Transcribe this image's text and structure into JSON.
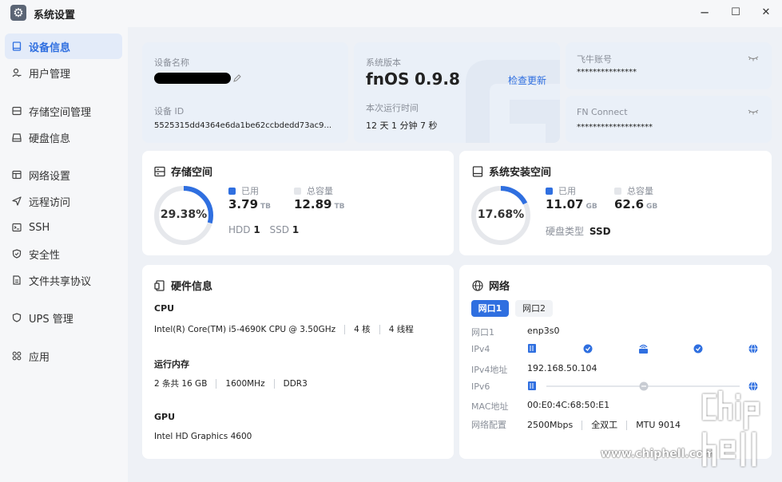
{
  "window": {
    "title": "系统设置",
    "minimize": "─",
    "maximize": "☐",
    "close": "✕"
  },
  "sidebar": {
    "items": [
      {
        "label": "设备信息"
      },
      {
        "label": "用户管理"
      },
      {
        "label": "存储空间管理"
      },
      {
        "label": "硬盘信息"
      },
      {
        "label": "网络设置"
      },
      {
        "label": "远程访问"
      },
      {
        "label": "SSH"
      },
      {
        "label": "安全性"
      },
      {
        "label": "文件共享协议"
      },
      {
        "label": "UPS 管理"
      },
      {
        "label": "应用"
      }
    ]
  },
  "device": {
    "name_label": "设备名称",
    "id_label": "设备 ID",
    "id_value": "5525315dd4364e6da1be62ccbdedd73ac9..."
  },
  "system": {
    "version_label": "系统版本",
    "os_name": "fnOS",
    "os_version": "0.9.8",
    "check_update": "检查更新",
    "uptime_label": "本次运行时间",
    "uptime_value": "12 天 1 分钟 7 秒"
  },
  "account": {
    "label": "飞牛账号",
    "value": "***************"
  },
  "fnconnect": {
    "label": "FN Connect",
    "value": "*******************"
  },
  "storage": {
    "title": "存储空间",
    "percent": "29.38%",
    "percent_value": 29.38,
    "used_label": "已用",
    "used_value": "3.79",
    "used_unit": "TB",
    "total_label": "总容量",
    "total_value": "12.89",
    "total_unit": "TB",
    "hdd_label": "HDD",
    "hdd_count": "1",
    "ssd_label": "SSD",
    "ssd_count": "1"
  },
  "system_storage": {
    "title": "系统安装空间",
    "percent": "17.68%",
    "percent_value": 17.68,
    "used_label": "已用",
    "used_value": "11.07",
    "used_unit": "GB",
    "total_label": "总容量",
    "total_value": "62.6",
    "total_unit": "GB",
    "disk_type_label": "硬盘类型",
    "disk_type_value": "SSD"
  },
  "hardware": {
    "title": "硬件信息",
    "cpu_label": "CPU",
    "cpu_model": "Intel(R) Core(TM) i5-4690K CPU @ 3.50GHz",
    "cpu_cores": "4 核",
    "cpu_threads": "4 线程",
    "mem_label": "运行内存",
    "mem_size": "2 条共 16 GB",
    "mem_freq": "1600MHz",
    "mem_type": "DDR3",
    "gpu_label": "GPU",
    "gpu_model": "Intel HD Graphics 4600"
  },
  "network": {
    "title": "网络",
    "tabs": [
      {
        "label": "网口1"
      },
      {
        "label": "网口2"
      }
    ],
    "port_label": "网口1",
    "port_value": "enp3s0",
    "ipv4_label": "IPv4",
    "ipv4_addr_label": "IPv4地址",
    "ipv4_addr_value": "192.168.50.104",
    "ipv6_label": "IPv6",
    "mac_label": "MAC地址",
    "mac_value": "00:E0:4C:68:50:E1",
    "config_label": "网络配置",
    "speed": "2500Mbps",
    "duplex": "全双工",
    "mtu": "MTU 9014"
  },
  "watermark": {
    "text": "www.chiphell.com",
    "logo": "chip hell"
  },
  "colors": {
    "accent": "#2f6fe0",
    "ring_track": "#e6e8ec",
    "sidebar_bg": "#f6f7f9"
  },
  "icons": [
    "gear-icon",
    "tablet-icon",
    "user-icon",
    "storage-icon",
    "disk-icon",
    "network-icon",
    "send-icon",
    "terminal-icon",
    "shield-icon",
    "document-icon",
    "ups-icon",
    "apps-icon",
    "pencil-icon",
    "eye-closed-icon",
    "globe-icon",
    "router-icon",
    "chip-icon"
  ]
}
